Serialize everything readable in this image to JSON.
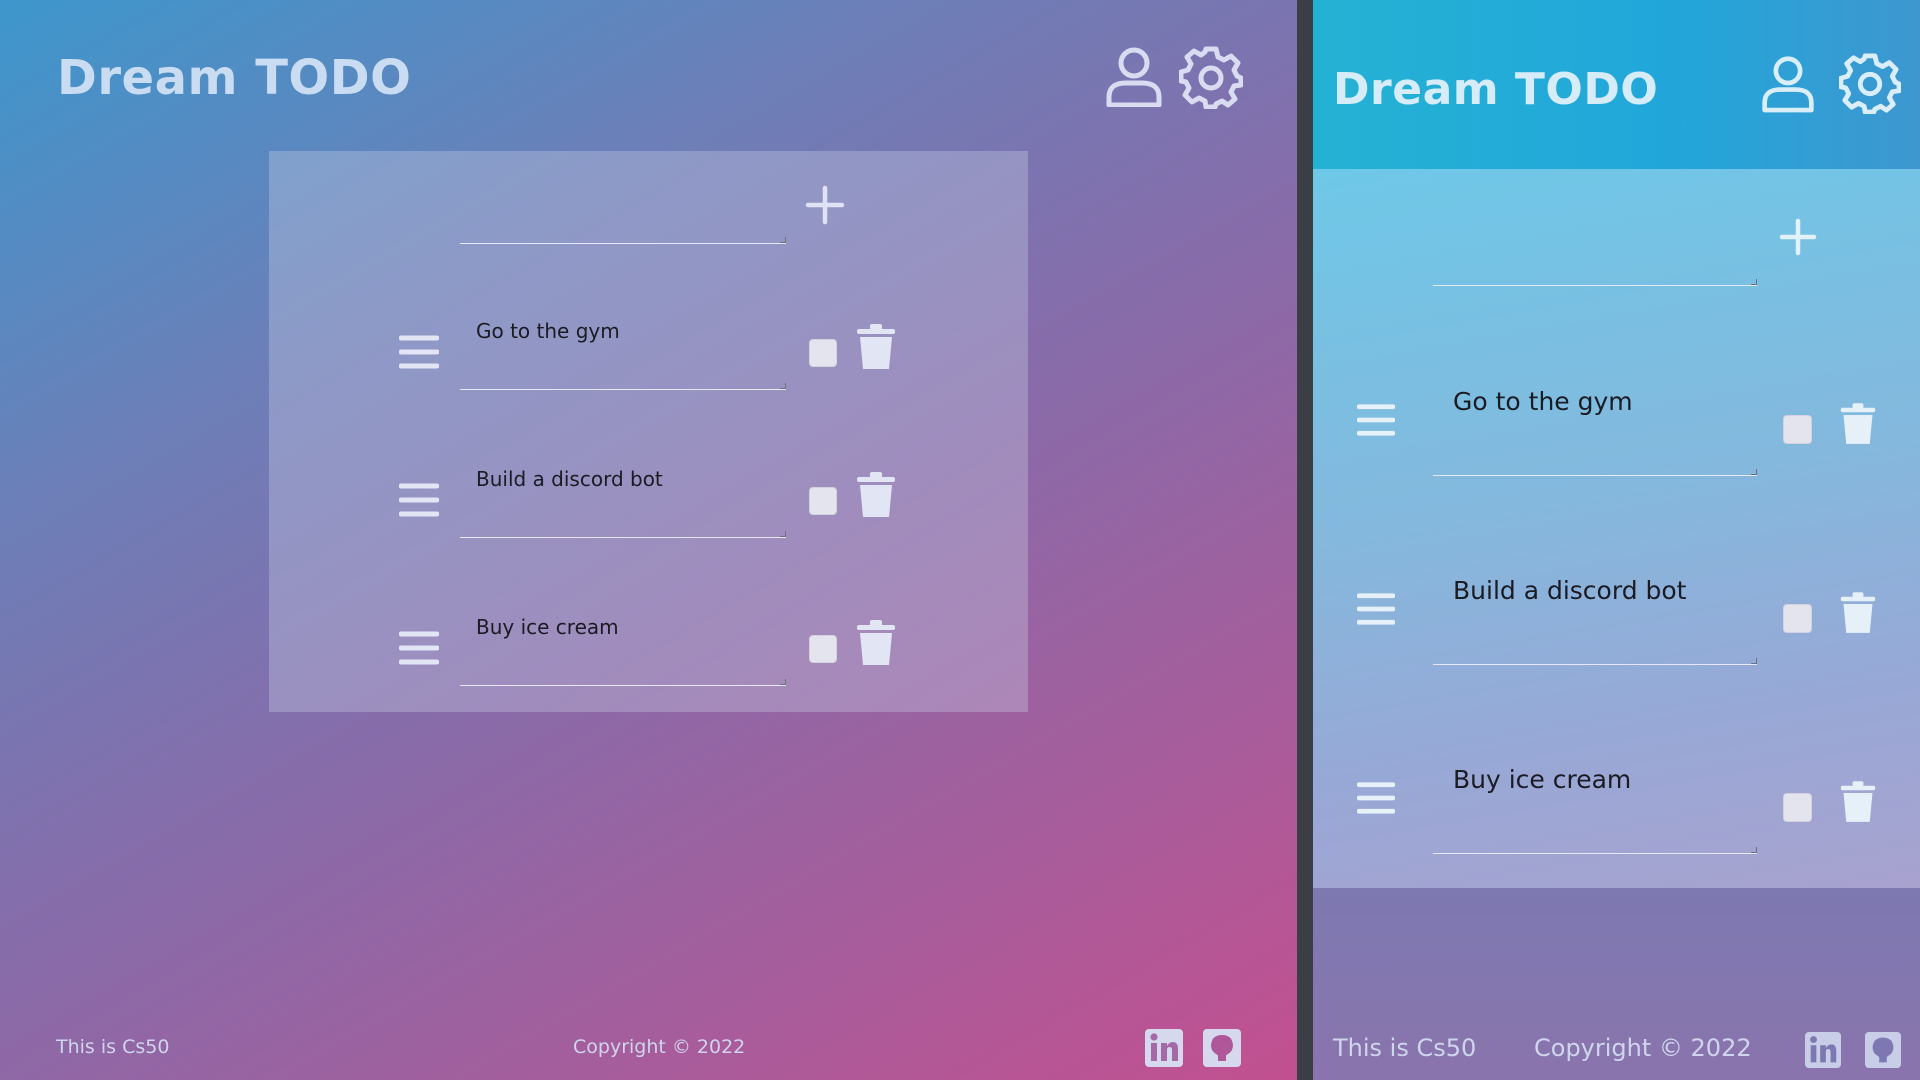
{
  "app": {
    "brand": "Dream TODO"
  },
  "new_task": {
    "value": "",
    "add_icon": "plus-icon"
  },
  "tasks": [
    {
      "text": "Go to the gym",
      "done": false
    },
    {
      "text": "Build a discord bot",
      "done": false
    },
    {
      "text": "Buy ice cream",
      "done": false
    }
  ],
  "header_icons": [
    "user-icon",
    "gear-icon"
  ],
  "row_icons": {
    "drag": "drag-handle-icon",
    "delete": "trash-icon"
  },
  "footer": {
    "left": "This is Cs50",
    "center": "Copyright © 2022",
    "social_icons": [
      "linkedin-icon",
      "github-icon"
    ]
  },
  "colors": {
    "gradient_start": "#3d97cc",
    "gradient_end": "#c25090",
    "mobile_header": "#22a6da",
    "icon": "#d9dcf0"
  }
}
